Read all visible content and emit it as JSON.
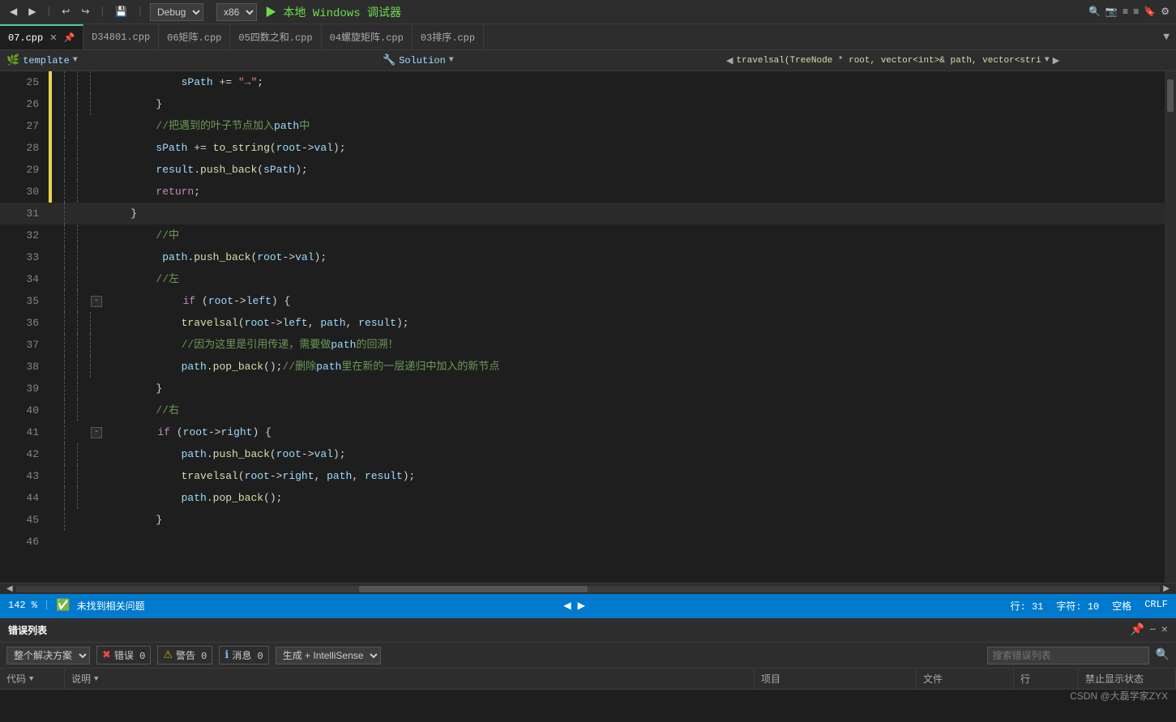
{
  "toolbar": {
    "debug_label": "Debug",
    "arch_label": "x86",
    "run_label": "▶ 本地 Windows 调试器",
    "pin_icon": "📌",
    "settings_icon": "⚙"
  },
  "tabs": [
    {
      "id": "07cpp",
      "label": "07.cpp",
      "active": true,
      "modified": false
    },
    {
      "id": "D34801cpp",
      "label": "D34801.cpp",
      "active": false
    },
    {
      "id": "06juzhen",
      "label": "06矩阵.cpp",
      "active": false
    },
    {
      "id": "05sishuzhi",
      "label": "05四数之和.cpp",
      "active": false
    },
    {
      "id": "04luoxuanjuzhen",
      "label": "04螺旋矩阵.cpp",
      "active": false
    },
    {
      "id": "03paixu",
      "label": "03排序.cpp",
      "active": false
    }
  ],
  "secondary_bar": {
    "file_icon": "🌿",
    "file_name": "template",
    "solution_icon": "🔧",
    "solution_name": "Solution",
    "func_name": "travelsal(TreeNode * root, vector<int>& path, vector<stri",
    "nav_left": "◀",
    "nav_right": "▶"
  },
  "lines": [
    {
      "num": "25",
      "yellow": true,
      "dashes": 3,
      "fold": null,
      "code": "            sPath += \"→\";"
    },
    {
      "num": "26",
      "yellow": true,
      "dashes": 3,
      "fold": null,
      "code": "        }"
    },
    {
      "num": "27",
      "yellow": true,
      "dashes": 2,
      "fold": null,
      "code": "        //把遇到的叶子节点加入path中"
    },
    {
      "num": "28",
      "yellow": true,
      "dashes": 2,
      "fold": null,
      "code": "        sPath += to_string(root->val);"
    },
    {
      "num": "29",
      "yellow": true,
      "dashes": 2,
      "fold": null,
      "code": "        result.push_back(sPath);"
    },
    {
      "num": "30",
      "yellow": true,
      "dashes": 2,
      "fold": null,
      "code": "        return;"
    },
    {
      "num": "31",
      "yellow": false,
      "dashes": 1,
      "fold": null,
      "code": "    }",
      "active": true
    },
    {
      "num": "32",
      "yellow": false,
      "dashes": 2,
      "fold": null,
      "code": "        //中"
    },
    {
      "num": "33",
      "yellow": false,
      "dashes": 2,
      "fold": null,
      "code": "         path.push_back(root->val);"
    },
    {
      "num": "34",
      "yellow": false,
      "dashes": 2,
      "fold": null,
      "code": "        //左"
    },
    {
      "num": "35",
      "yellow": false,
      "dashes": 2,
      "fold": "-",
      "code": "            if (root->left) {"
    },
    {
      "num": "36",
      "yellow": false,
      "dashes": 3,
      "fold": null,
      "code": "            travelsal(root->left, path, result);"
    },
    {
      "num": "37",
      "yellow": false,
      "dashes": 3,
      "fold": null,
      "code": "            //因为这里是引用传递，需要做path的回溯！"
    },
    {
      "num": "38",
      "yellow": false,
      "dashes": 3,
      "fold": null,
      "code": "            path.pop_back();//删除path里在新的一层递归中加入的新节点"
    },
    {
      "num": "39",
      "yellow": false,
      "dashes": 2,
      "fold": null,
      "code": "        }"
    },
    {
      "num": "40",
      "yellow": false,
      "dashes": 2,
      "fold": null,
      "code": "        //右"
    },
    {
      "num": "41",
      "yellow": false,
      "dashes": 1,
      "fold": "-",
      "code": "        if (root->right) {"
    },
    {
      "num": "42",
      "yellow": false,
      "dashes": 2,
      "fold": null,
      "code": "            path.push_back(root->val);"
    },
    {
      "num": "43",
      "yellow": false,
      "dashes": 2,
      "fold": null,
      "code": "            travelsal(root->right, path, result);"
    },
    {
      "num": "44",
      "yellow": false,
      "dashes": 2,
      "fold": null,
      "code": "            path.pop_back();"
    },
    {
      "num": "45",
      "yellow": false,
      "dashes": 1,
      "fold": null,
      "code": "        }"
    },
    {
      "num": "46",
      "yellow": false,
      "dashes": 0,
      "fold": null,
      "code": ""
    }
  ],
  "status": {
    "zoom": "142 %",
    "ok_icon": "✅",
    "msg": "未找到相关问题",
    "row_label": "行: 31",
    "col_label": "字符: 10",
    "encoding": "空格",
    "line_ending": "CRLF"
  },
  "error_panel": {
    "title": "错误列表",
    "pin_icon": "📌",
    "minus_icon": "−",
    "close_icon": "×",
    "scope_label": "整个解决方案",
    "error_label": "错误 0",
    "warning_label": "警告 0",
    "message_label": "消息 0",
    "gen_label": "生成 + IntelliSense",
    "search_placeholder": "搜索错误列表",
    "columns": {
      "code": "代码",
      "desc": "说明",
      "proj": "项目",
      "file": "文件",
      "line": "行",
      "suppress": "禁止显示状态"
    }
  },
  "watermark": "CSDN @大磊学家ZYX"
}
